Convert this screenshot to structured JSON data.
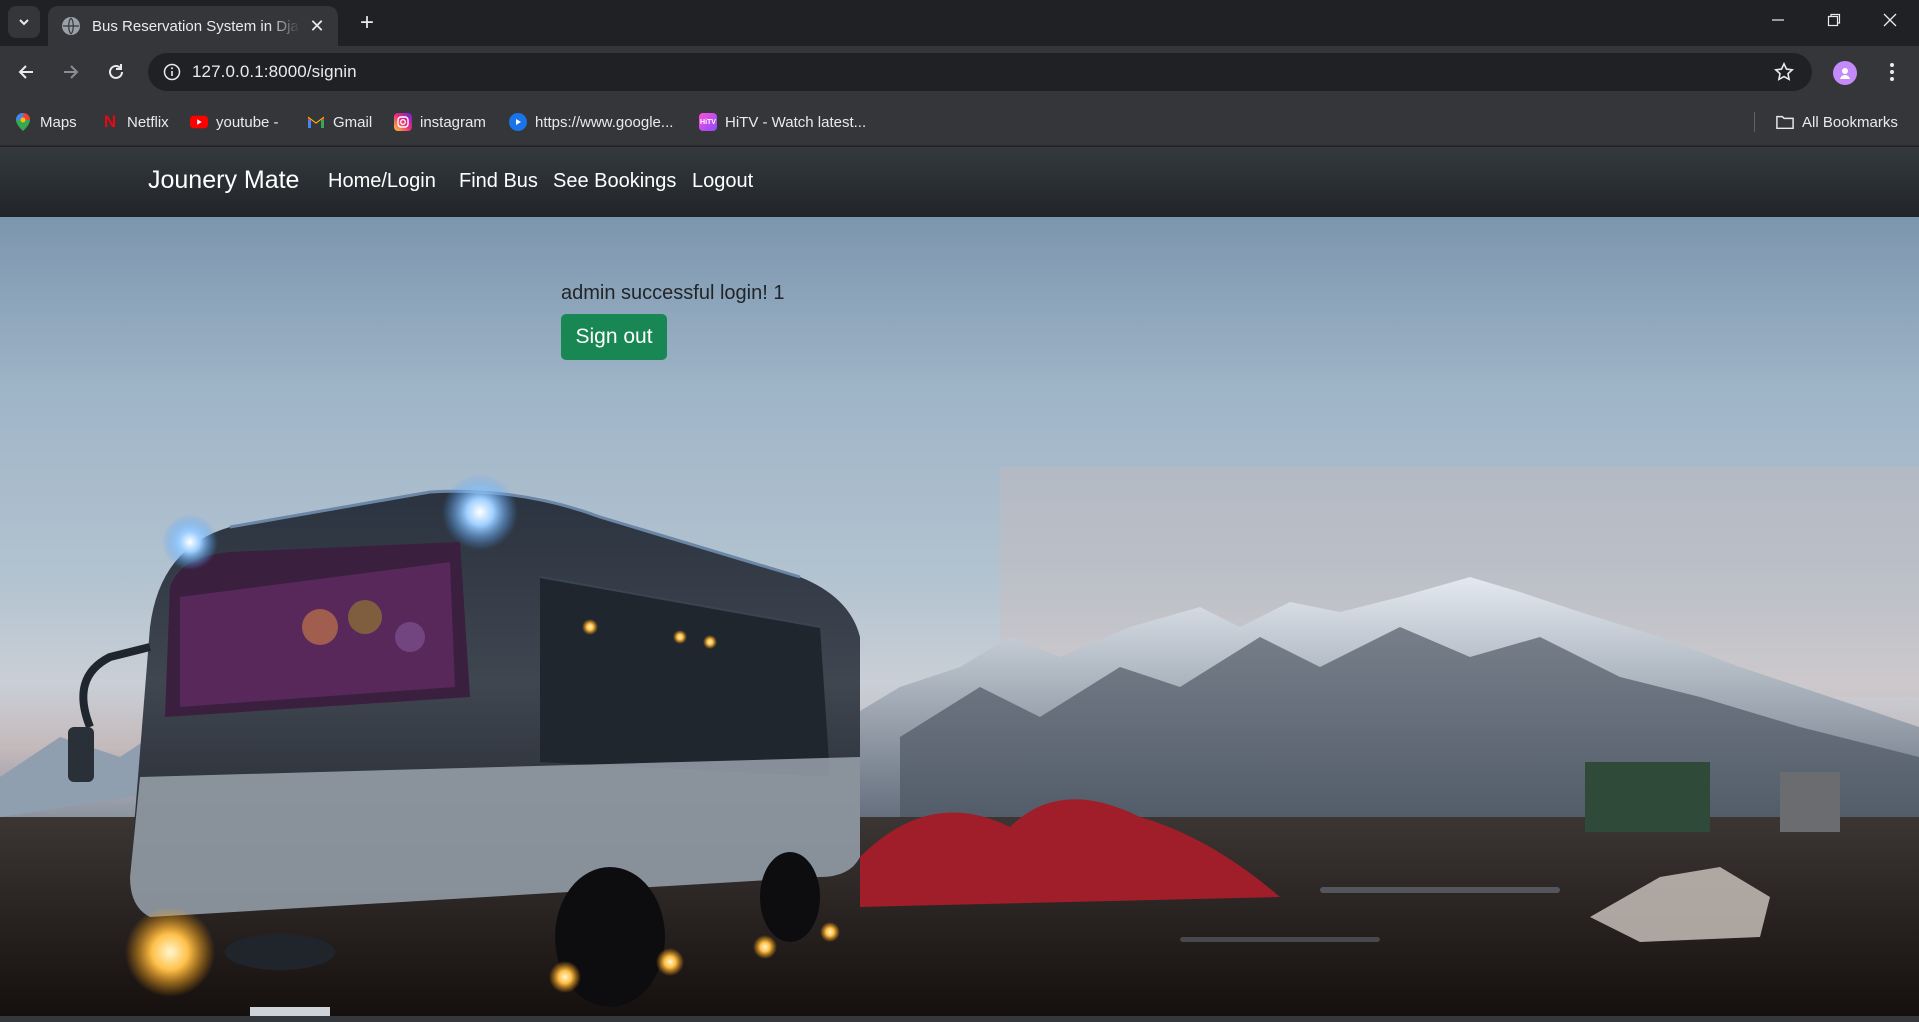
{
  "browser": {
    "tab_title": "Bus Reservation System in Django",
    "url": "127.0.0.1:8000/signin",
    "bookmarks": [
      {
        "label": "Maps",
        "icon": "maps-pin-icon"
      },
      {
        "label": "Netflix",
        "icon": "netflix-icon"
      },
      {
        "label": "youtube -",
        "icon": "youtube-icon"
      },
      {
        "label": "Gmail",
        "icon": "gmail-icon"
      },
      {
        "label": "instagram",
        "icon": "instagram-icon"
      },
      {
        "label": "https://www.google...",
        "icon": "play-icon"
      },
      {
        "label": "HiTV - Watch latest...",
        "icon": "hitv-icon"
      }
    ],
    "all_bookmarks": "All Bookmarks"
  },
  "navbar": {
    "brand": "Jounery Mate",
    "links": [
      "Home/Login",
      "Find Bus",
      "See Bookings",
      "Logout"
    ]
  },
  "main": {
    "message": "admin successful login! 1",
    "signout_label": "Sign out"
  },
  "colors": {
    "navbar_bg": "#212529",
    "button_green": "#198754",
    "chrome_dark": "#202124",
    "chrome_toolbar": "#35363a"
  }
}
